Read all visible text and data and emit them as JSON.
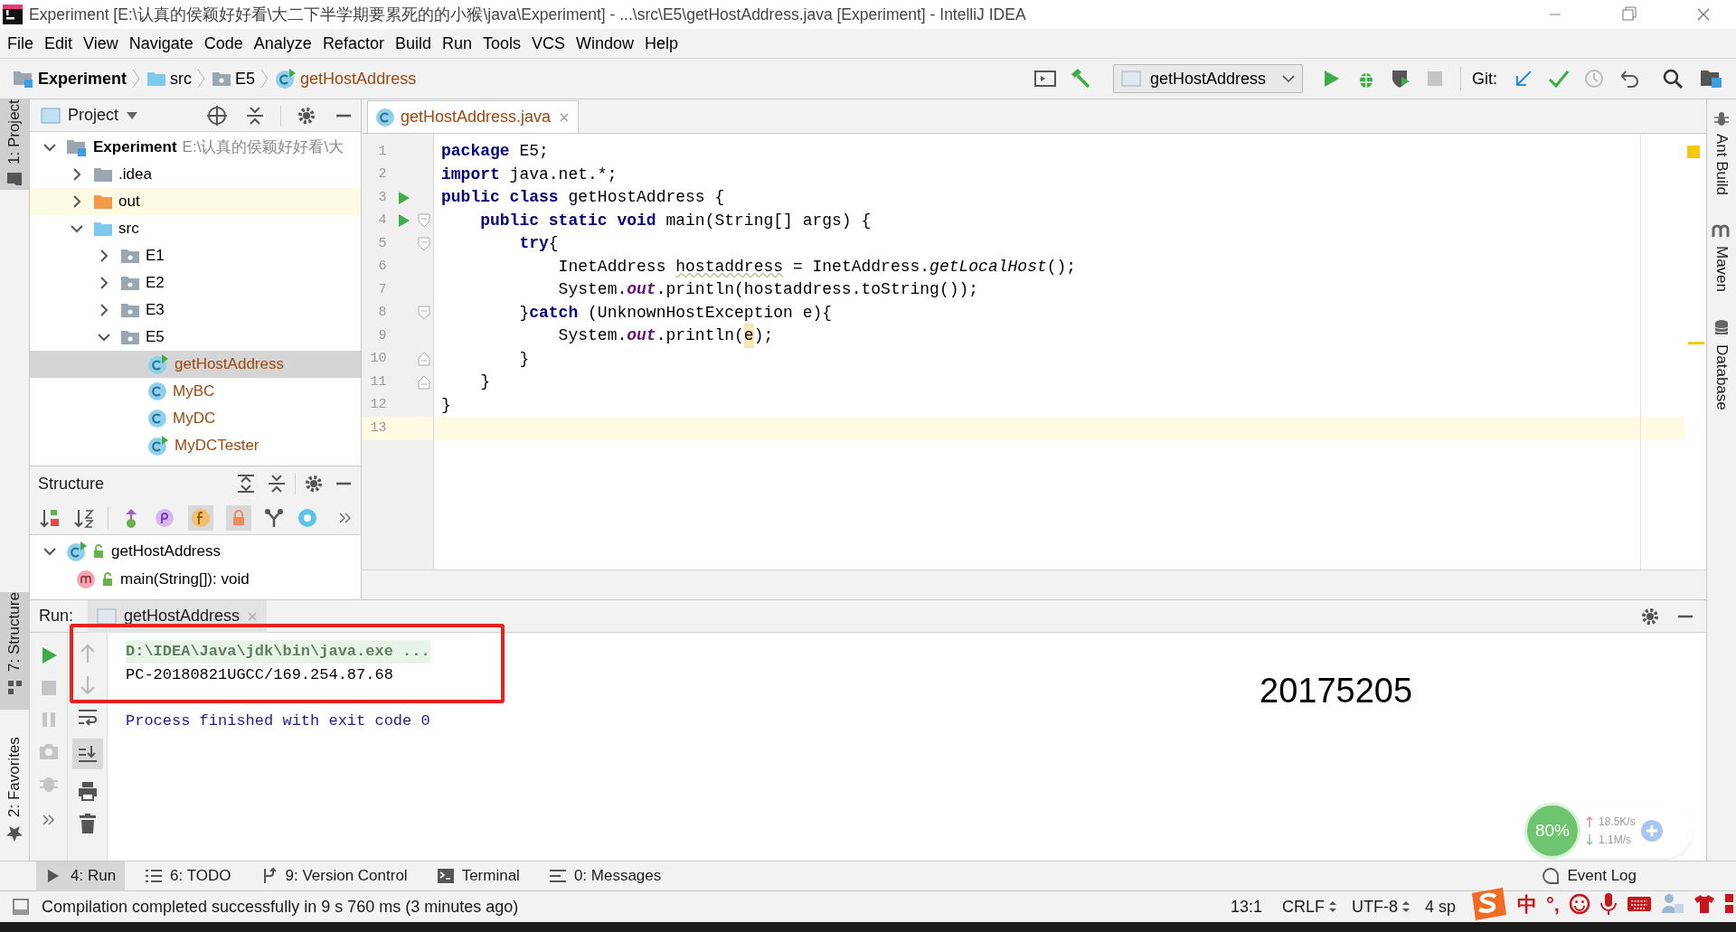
{
  "window": {
    "title": "Experiment [E:\\认真的侯颖好好看\\大二下半学期要累死的的小猴\\java\\Experiment] - ...\\src\\E5\\getHostAddress.java [Experiment] - IntelliJ IDEA"
  },
  "menu": [
    "File",
    "Edit",
    "View",
    "Navigate",
    "Code",
    "Analyze",
    "Refactor",
    "Build",
    "Run",
    "Tools",
    "VCS",
    "Window",
    "Help"
  ],
  "breadcrumbs": [
    {
      "label": "Experiment",
      "kind": "project"
    },
    {
      "label": "src",
      "kind": "source"
    },
    {
      "label": "E5",
      "kind": "package"
    },
    {
      "label": "getHostAddress",
      "kind": "runnable_class"
    }
  ],
  "toolbar": {
    "run_config": "getHostAddress",
    "git_label": "Git:"
  },
  "left_stripe": [
    {
      "label": "1: Project",
      "kind": "project",
      "selected": true
    },
    {
      "label": "7: Structure",
      "kind": "structure",
      "selected": true
    },
    {
      "label": "2: Favorites",
      "kind": "favorites",
      "selected": false
    }
  ],
  "right_stripe": [
    {
      "label": "Ant Build",
      "kind": "ant"
    },
    {
      "label": "Maven",
      "kind": "maven"
    },
    {
      "label": "Database",
      "kind": "database"
    }
  ],
  "project_panel": {
    "title": "Project",
    "tree": [
      {
        "label": "Experiment",
        "path": "E:\\认真的侯颖好好看\\大",
        "kind": "project",
        "expanded": true,
        "selected": false,
        "children": [
          {
            "label": ".idea",
            "kind": "folder",
            "expanded": false,
            "selected": false
          },
          {
            "label": "out",
            "kind": "excluded",
            "expanded": false,
            "selected": false
          },
          {
            "label": "src",
            "kind": "source",
            "expanded": true,
            "selected": false,
            "children": [
              {
                "label": "E1",
                "kind": "package",
                "expanded": false,
                "selected": false
              },
              {
                "label": "E2",
                "kind": "package",
                "expanded": false,
                "selected": false
              },
              {
                "label": "E3",
                "kind": "package",
                "expanded": false,
                "selected": false
              },
              {
                "label": "E5",
                "kind": "package",
                "expanded": true,
                "selected": false,
                "children": [
                  {
                    "label": "getHostAddress",
                    "kind": "runnable_class",
                    "selected": true
                  },
                  {
                    "label": "MyBC",
                    "kind": "class",
                    "selected": false
                  },
                  {
                    "label": "MyDC",
                    "kind": "class",
                    "selected": false
                  },
                  {
                    "label": "MyDCTester",
                    "kind": "runnable_class",
                    "selected": false
                  }
                ]
              }
            ]
          }
        ]
      }
    ]
  },
  "structure_panel": {
    "title": "Structure",
    "tree": [
      {
        "label": "getHostAddress",
        "kind": "runnable_class",
        "expanded": true,
        "children": [
          {
            "label": "main(String[]): void",
            "kind": "method"
          }
        ]
      }
    ]
  },
  "editor": {
    "tabs": [
      {
        "label": "getHostAddress.java",
        "selected": true
      }
    ],
    "lines": [
      {
        "number": "1",
        "current": false,
        "run": false,
        "fold_start": false,
        "fold_end": false,
        "tokens": [
          {
            "kind": "keyword",
            "text": "package"
          },
          {
            "kind": "plain",
            "text": " E5;"
          }
        ]
      },
      {
        "number": "2",
        "current": false,
        "run": false,
        "fold_start": false,
        "fold_end": false,
        "tokens": [
          {
            "kind": "keyword",
            "text": "import"
          },
          {
            "kind": "plain",
            "text": " java.net.*;"
          }
        ]
      },
      {
        "number": "3",
        "current": false,
        "run": true,
        "fold_start": false,
        "fold_end": false,
        "tokens": [
          {
            "kind": "keyword",
            "text": "public class"
          },
          {
            "kind": "plain",
            "text": " getHostAddress {"
          }
        ]
      },
      {
        "number": "4",
        "current": false,
        "run": true,
        "fold_start": true,
        "fold_end": false,
        "tokens": [
          {
            "kind": "keyword",
            "text": "    public static void"
          },
          {
            "kind": "plain",
            "text": " main(String[] args) {"
          }
        ]
      },
      {
        "number": "5",
        "current": false,
        "run": false,
        "fold_start": true,
        "fold_end": false,
        "tokens": [
          {
            "kind": "keyword",
            "text": "        try"
          },
          {
            "kind": "plain",
            "text": "{"
          }
        ]
      },
      {
        "number": "6",
        "current": false,
        "run": false,
        "fold_start": false,
        "fold_end": false,
        "tokens": [
          {
            "kind": "plain",
            "text": "            InetAddress "
          },
          {
            "kind": "warning",
            "text": "hostaddress"
          },
          {
            "kind": "plain",
            "text": " = InetAddress."
          },
          {
            "kind": "italic",
            "text": "getLocalHost"
          },
          {
            "kind": "plain",
            "text": "();"
          }
        ]
      },
      {
        "number": "7",
        "current": false,
        "run": false,
        "fold_start": false,
        "fold_end": false,
        "tokens": [
          {
            "kind": "plain",
            "text": "            System."
          },
          {
            "kind": "field",
            "text": "out"
          },
          {
            "kind": "plain",
            "text": ".println(hostaddress.toString());"
          }
        ]
      },
      {
        "number": "8",
        "current": false,
        "run": false,
        "fold_start": true,
        "fold_end": false,
        "tokens": [
          {
            "kind": "plain",
            "text": "        }"
          },
          {
            "kind": "keyword",
            "text": "catch"
          },
          {
            "kind": "plain",
            "text": " (UnknownHostException e){"
          }
        ]
      },
      {
        "number": "9",
        "current": false,
        "run": false,
        "fold_start": false,
        "fold_end": false,
        "tokens": [
          {
            "kind": "plain",
            "text": "            System."
          },
          {
            "kind": "field",
            "text": "out"
          },
          {
            "kind": "plain",
            "text": ".println("
          },
          {
            "kind": "match",
            "text": "e"
          },
          {
            "kind": "plain",
            "text": ");"
          }
        ]
      },
      {
        "number": "10",
        "current": false,
        "run": false,
        "fold_start": false,
        "fold_end": true,
        "tokens": [
          {
            "kind": "plain",
            "text": "        }"
          }
        ]
      },
      {
        "number": "11",
        "current": false,
        "run": false,
        "fold_start": false,
        "fold_end": true,
        "tokens": [
          {
            "kind": "plain",
            "text": "    }"
          }
        ]
      },
      {
        "number": "12",
        "current": false,
        "run": false,
        "fold_start": false,
        "fold_end": false,
        "tokens": [
          {
            "kind": "plain",
            "text": "}"
          }
        ]
      },
      {
        "number": "13",
        "current": true,
        "run": false,
        "fold_start": false,
        "fold_end": false
      }
    ]
  },
  "run_panel": {
    "label": "Run:",
    "tab": "getHostAddress",
    "output": [
      {
        "kind": "command",
        "text": "D:\\IDEA\\Java\\jdk\\bin\\java.exe ..."
      },
      {
        "kind": "stdout",
        "text": "PC-20180821UGCC/169.254.87.68"
      },
      {
        "kind": "system",
        "text": "Process finished with exit code 0"
      }
    ],
    "annotation": "20175205"
  },
  "tool_tabs": [
    {
      "label": "4: Run",
      "kind": "run",
      "selected": true
    },
    {
      "label": "6: TODO",
      "kind": "todo",
      "selected": false
    },
    {
      "label": "9: Version Control",
      "kind": "vcs",
      "selected": false
    },
    {
      "label": "Terminal",
      "kind": "terminal",
      "selected": false
    },
    {
      "label": "0: Messages",
      "kind": "messages",
      "selected": false
    }
  ],
  "event_log": "Event Log",
  "status_bar": {
    "message": "Compilation completed successfully in 9 s 760 ms (3 minutes ago)",
    "position": "13:1",
    "line_separator": "CRLF",
    "encoding": "UTF-8",
    "indent": "4 sp"
  },
  "speed_widget": {
    "percent": "80%",
    "upload": "18.5K/s",
    "download": "1.1M/s"
  },
  "ime_bar": {
    "mode": "中",
    "punctuation": "°,"
  }
}
